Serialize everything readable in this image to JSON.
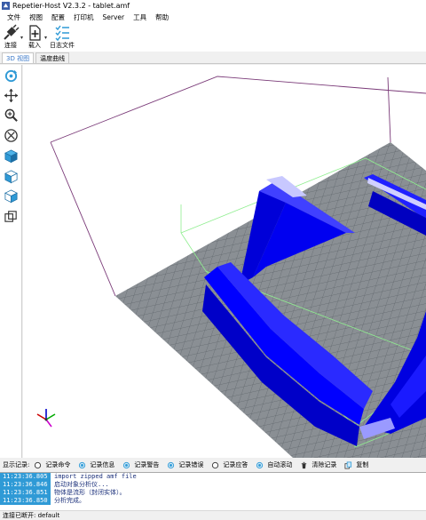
{
  "window": {
    "title": "Repetier-Host V2.3.2 - tablet.amf"
  },
  "menu": [
    "文件",
    "视图",
    "配置",
    "打印机",
    "Server",
    "工具",
    "帮助"
  ],
  "toolbar": {
    "connect_label": "连接",
    "load_label": "载入",
    "log_label": "日志文件"
  },
  "tabs": [
    "3D 视图",
    "温度曲线"
  ],
  "log_controls": {
    "label": "显示记录:",
    "options": [
      "记录命令",
      "记录信息",
      "记录警告",
      "记录错误",
      "记录应答",
      "自动滚动",
      "清除记录",
      "复制"
    ]
  },
  "log_entries": [
    {
      "time": "11:23:36.805",
      "message": "import zipped amf file"
    },
    {
      "time": "11:23:36.846",
      "message": "启动对象分析仪..."
    },
    {
      "time": "11:23:36.851",
      "message": "物体是流形（封闭实体）。"
    },
    {
      "time": "11:23:36.850",
      "message": "分析完成。"
    }
  ],
  "status": {
    "text": "连接已断开: default"
  },
  "colors": {
    "model": "#0000ff",
    "bed": "#8a8f94",
    "accent": "#2f9ad6",
    "bounding_box": "#90ee90"
  }
}
